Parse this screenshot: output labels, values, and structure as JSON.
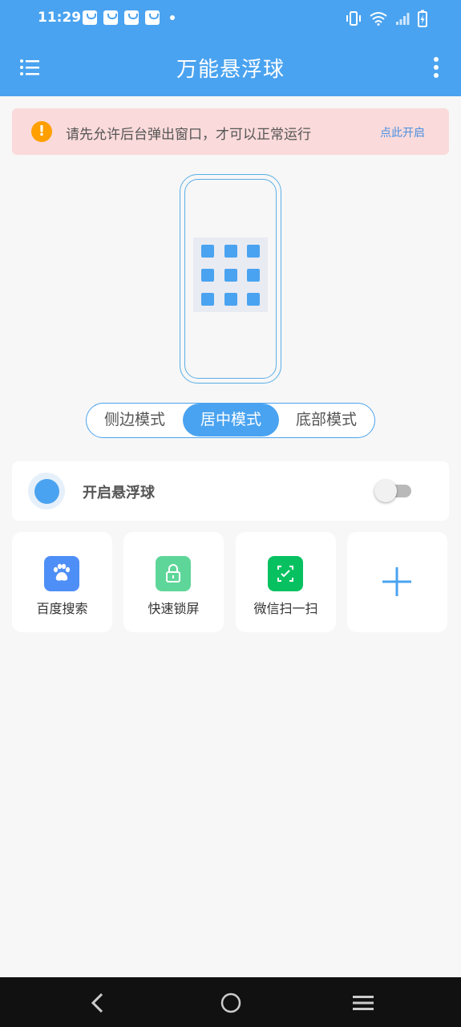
{
  "status_bar": {
    "time": "11:29",
    "icons": [
      "shopping-bag-icon",
      "shopping-bag-icon",
      "shopping-bag-icon",
      "shopping-bag-icon",
      "notification-dot-icon",
      "vibrate-icon",
      "wifi-icon",
      "signal-icon",
      "battery-charging-icon"
    ]
  },
  "app_bar": {
    "title": "万能悬浮球",
    "menu_icon": "list-icon",
    "more_icon": "more-vertical-icon"
  },
  "alert": {
    "message": "请先允许后台弹出窗口，才可以正常运行",
    "action": "点此开启",
    "icon": "warning-icon"
  },
  "mode_selector": {
    "options": [
      "侧边模式",
      "居中模式",
      "底部模式"
    ],
    "selected": "居中模式"
  },
  "float_toggle": {
    "label": "开启悬浮球",
    "enabled": false
  },
  "shortcuts": [
    {
      "label": "百度搜索",
      "icon": "baidu-paw-icon",
      "color": "#4e8ef7"
    },
    {
      "label": "快速锁屏",
      "icon": "lock-icon",
      "color": "#5fd699"
    },
    {
      "label": "微信扫一扫",
      "icon": "scan-icon",
      "color": "#07c160"
    },
    {
      "label": "",
      "icon": "plus-icon",
      "color": "#4aa3f0"
    }
  ],
  "nav_bar": {
    "buttons": [
      "back-icon",
      "home-icon",
      "recents-menu-icon"
    ]
  },
  "colors": {
    "primary": "#4aa3f0",
    "alert_bg": "#fadada",
    "warning": "#ff9f00",
    "link": "#4a90e2"
  }
}
